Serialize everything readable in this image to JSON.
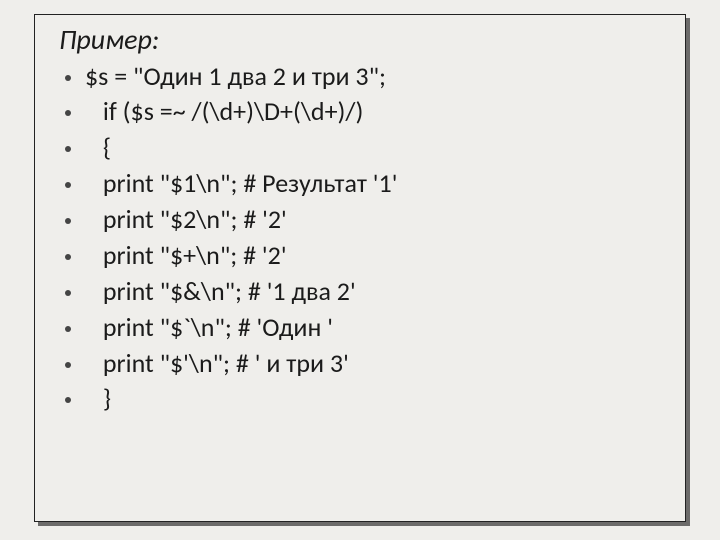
{
  "title": "Пример:",
  "lines": [
    "$s = \"Один 1 два 2 и три 3\";",
    " if ($s =~ /(\\d+)\\D+(\\d+)/)",
    " {",
    " print \"$1\\n\"; # Результат '1'",
    " print \"$2\\n\"; # '2'",
    " print \"$+\\n\"; # '2'",
    " print \"$&\\n\"; # '1 два 2'",
    " print \"$`\\n\"; # 'Один '",
    " print \"$'\\n\"; # ' и три 3'",
    " }"
  ]
}
